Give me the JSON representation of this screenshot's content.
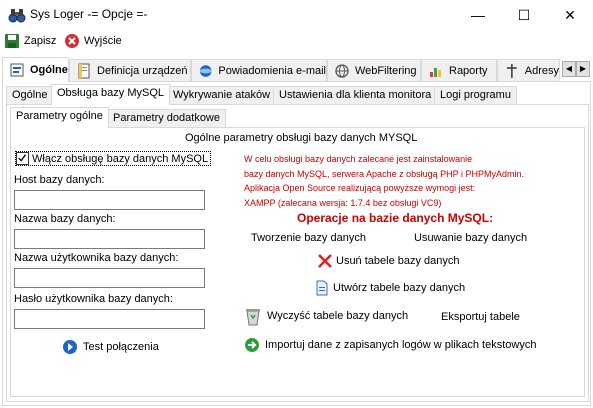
{
  "window": {
    "title": "Sys Loger -= Opcje =-",
    "minimize_glyph": "—",
    "maximize_glyph": "☐",
    "close_glyph": "✕"
  },
  "toolbar": {
    "save_label": "Zapisz",
    "exit_label": "Wyjście"
  },
  "main_tabs": [
    {
      "label": "Ogólne",
      "icon": "settings-page-icon",
      "active": true
    },
    {
      "label": "Definicja urządzeń",
      "icon": "document-icon",
      "active": false
    },
    {
      "label": "Powiadomienia e-mail",
      "icon": "mail-globe-icon",
      "active": false
    },
    {
      "label": "WebFiltering",
      "icon": "globe-icon",
      "active": false
    },
    {
      "label": "Raporty",
      "icon": "chart-icon",
      "active": false
    },
    {
      "label": "Adresy",
      "icon": "pin-icon",
      "active": false
    }
  ],
  "tab_scroll": {
    "left": "◀",
    "right": "▶"
  },
  "sub_tabs": [
    {
      "label": "Ogólne",
      "active": false
    },
    {
      "label": "Obsługa bazy MySQL",
      "active": true
    },
    {
      "label": "Wykrywanie ataków",
      "active": false
    },
    {
      "label": "Ustawienia dla klienta monitora",
      "active": false
    },
    {
      "label": "Logi programu",
      "active": false
    }
  ],
  "inner_tabs": [
    {
      "label": "Parametry ogólne",
      "active": true
    },
    {
      "label": "Parametry dodatkowe",
      "active": false
    }
  ],
  "section_title": "Ogólne parametry obsługi bazy danych MYSQL",
  "form": {
    "enable_checkbox_label": "Włącz obsługę bazy danych MySQL",
    "enable_checked": true,
    "host_label": "Host bazy danych:",
    "host_value": "",
    "dbname_label": "Nazwa bazy danych:",
    "dbname_value": "",
    "user_label": "Nazwa użytkownika bazy danych:",
    "user_value": "",
    "password_label": "Hasło użytkownika bazy danych:",
    "password_value": "",
    "test_label": "Test połączenia"
  },
  "note_lines": [
    "W celu obsługi bazy danych zalecane jest zainstalowanie",
    "bazy danych MySQL, serwera Apache z obsługą PHP i PHPMyAdmin.",
    "Aplikacja Open Source realizującą powyższe wymogi jest:",
    "XAMPP (zalecana wersja: 1.7.4 bez obsługi VC9)"
  ],
  "operations": {
    "heading": "Operacje na bazie danych MySQL:",
    "create_db": "Tworzenie bazy danych",
    "delete_db": "Usuwanie bazy danych",
    "delete_tables": "Usuń tabele bazy danych",
    "create_tables": "Utwórz tabele bazy danych",
    "clear_tables": "Wyczyść tabele bazy danych",
    "export_table": "Eksportuj tabele",
    "import_logs": "Importuj dane z zapisanych logów w plikach tekstowych"
  },
  "colors": {
    "red_text": "#cc0000",
    "tab_bg": "#f0f0f0",
    "border": "#d9d9d9"
  }
}
